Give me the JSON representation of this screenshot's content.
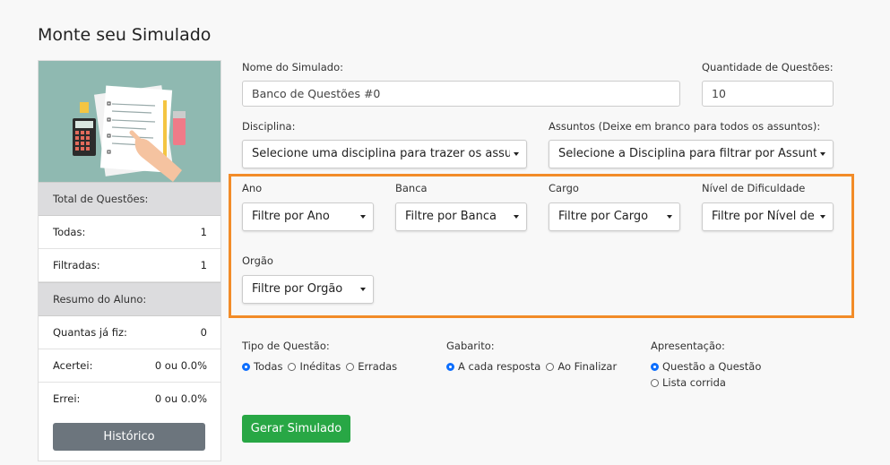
{
  "page": {
    "title": "Monte seu Simulado"
  },
  "sidebar": {
    "total_header": "Total de Questões:",
    "todas_label": "Todas:",
    "todas_value": "1",
    "filtradas_label": "Filtradas:",
    "filtradas_value": "1",
    "resumo_header": "Resumo do Aluno:",
    "quantas_label": "Quantas já fiz:",
    "quantas_value": "0",
    "acertei_label": "Acertei:",
    "acertei_value": "0 ou 0.0%",
    "errei_label": "Errei:",
    "errei_value": "0 ou 0.0%",
    "historico_button": "Histórico"
  },
  "form": {
    "nome_label": "Nome do Simulado:",
    "nome_value": "Banco de Questões #0",
    "qtd_label": "Quantidade de Questões:",
    "qtd_value": "10",
    "disciplina_label": "Disciplina:",
    "disciplina_value": "Selecione uma disciplina para trazer os assuntos",
    "assuntos_label": "Assuntos (Deixe em branco para todos os assuntos):",
    "assuntos_value": "Selecione a Disciplina para filtrar por Assuntos"
  },
  "filters": {
    "ano_label": "Ano",
    "ano_value": "Filtre por Ano",
    "banca_label": "Banca",
    "banca_value": "Filtre por Banca",
    "cargo_label": "Cargo",
    "cargo_value": "Filtre por Cargo",
    "nivel_label": "Nível de Dificuldade",
    "nivel_value": "Filtre por Nível de Dificuldade",
    "orgao_label": "Orgão",
    "orgao_value": "Filtre por Orgão"
  },
  "options": {
    "tipo_label": "Tipo de Questão:",
    "tipo_todas": "Todas",
    "tipo_ineditas": "Inéditas",
    "tipo_erradas": "Erradas",
    "gabarito_label": "Gabarito:",
    "gab_cada": "A cada resposta",
    "gab_final": "Ao Finalizar",
    "apresentacao_label": "Apresentação:",
    "apr_questao": "Questão a Questão",
    "apr_lista": "Lista corrida"
  },
  "actions": {
    "gerar_button": "Gerar Simulado"
  },
  "colors": {
    "highlight_border": "#f28c28",
    "primary_radio": "#0d6efd",
    "success": "#28a745",
    "secondary": "#6c757d"
  }
}
